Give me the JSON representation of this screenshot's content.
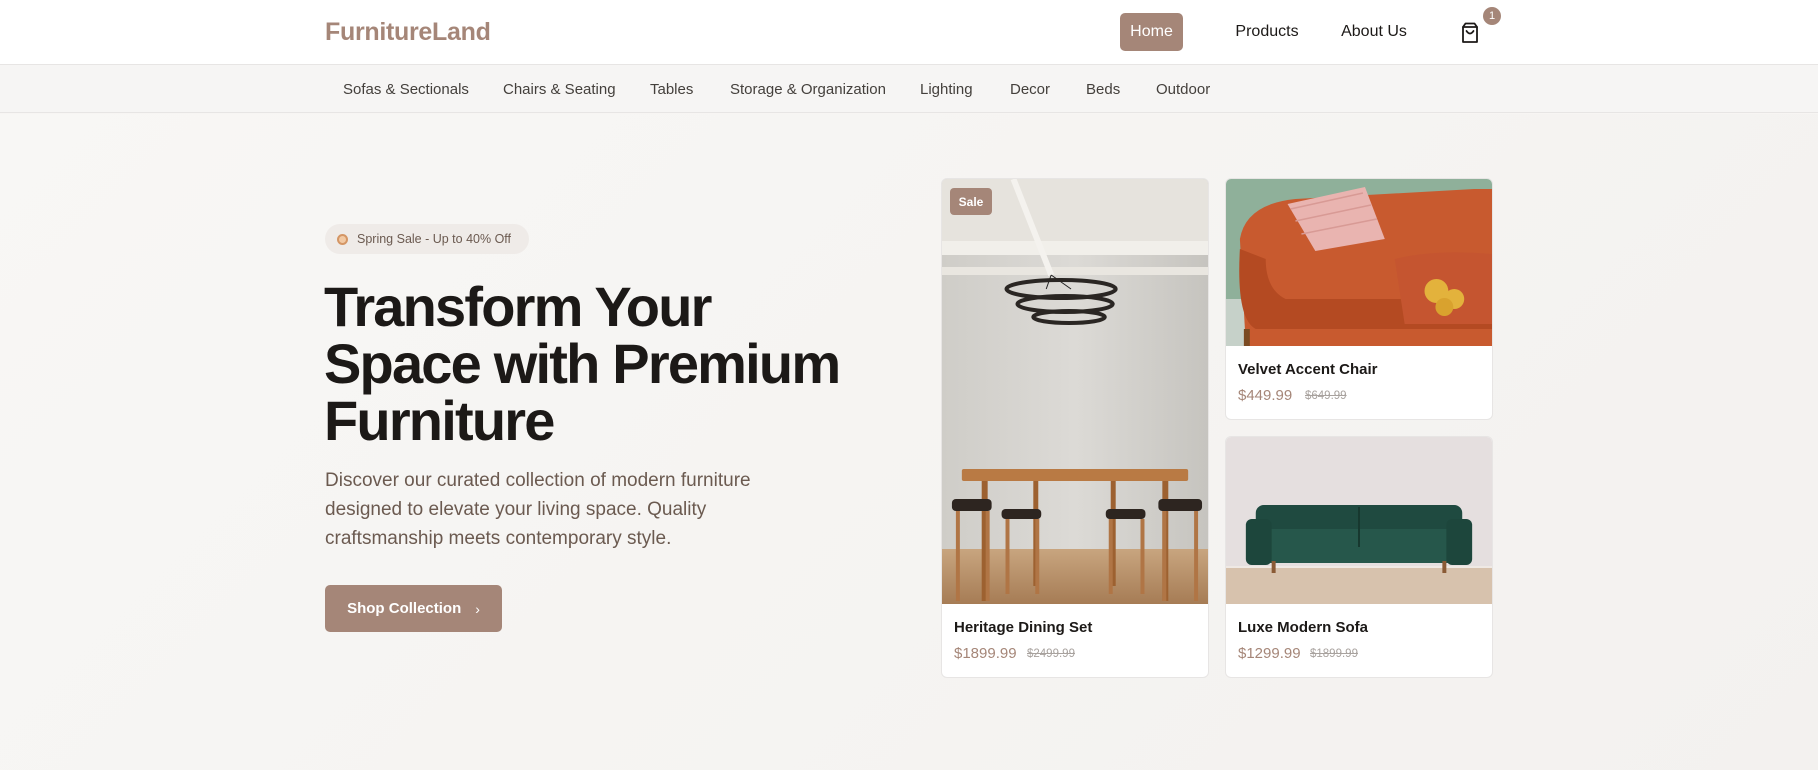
{
  "header": {
    "logo": "FurnitureLand",
    "nav": [
      {
        "label": "Home",
        "active": true
      },
      {
        "label": "Products",
        "active": false
      },
      {
        "label": "About Us",
        "active": false
      }
    ],
    "cart_count": "1",
    "cart_icon": "shopping-bag-icon"
  },
  "categories": [
    "Sofas & Sectionals",
    "Chairs & Seating",
    "Tables",
    "Storage & Organization",
    "Lighting",
    "Decor",
    "Beds",
    "Outdoor"
  ],
  "hero": {
    "badge": "Spring Sale - Up to 40% Off",
    "title": "Transform Your Space with Premium Furniture",
    "subtitle": "Discover our curated collection of modern furniture designed to elevate your living space. Quality craftsmanship meets contemporary style.",
    "cta": "Shop Collection",
    "cta_icon": "chevron-right-icon"
  },
  "products": [
    {
      "name": "Heritage Dining Set",
      "price": "$1899.99",
      "old_price": "$2499.99",
      "tag": "Sale"
    },
    {
      "name": "Velvet Accent Chair",
      "price": "$449.99",
      "old_price": "$649.99"
    },
    {
      "name": "Luxe Modern Sofa",
      "price": "$1299.99",
      "old_price": "$1899.99"
    }
  ],
  "colors": {
    "accent": "#a58678",
    "text": "#1c1917",
    "muted": "#6b5a50",
    "background": "#f7f5f3"
  }
}
